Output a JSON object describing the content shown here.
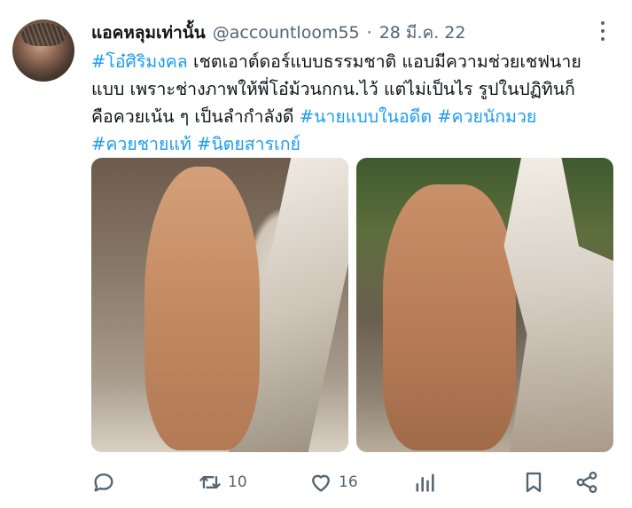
{
  "tweet": {
    "display_name": "แอคหลุมเท่านั้น",
    "handle": "@accountloom55",
    "separator": "·",
    "date": "28 มี.ค. 22",
    "lines": [
      [
        {
          "t": "#โอ๋ศิริมงคล",
          "tag": true
        },
        {
          "t": " เชตเอาต์ดอร์แบบธรรมชาติ แอบมีความช่วยเชฟนาย",
          "tag": false
        }
      ],
      [
        {
          "t": "แบบ เพราะช่างภาพให้พี่โอ๋ม้วนกกน.ไว้ แต่ไม่เป็นไร รูปในปฏิทินก็",
          "tag": false
        }
      ],
      [
        {
          "t": "คือควยเน้น ๆ เป็นลำกำลังดี ",
          "tag": false
        },
        {
          "t": "#นายแบบในอดีต",
          "tag": true
        },
        {
          "t": " ",
          "tag": false
        },
        {
          "t": "#ควยนักมวย",
          "tag": true
        }
      ],
      [
        {
          "t": "#ควยชายแท้",
          "tag": true
        },
        {
          "t": " ",
          "tag": false
        },
        {
          "t": "#นิตยสารเกย์",
          "tag": true
        }
      ]
    ]
  },
  "actions": {
    "reply_count": "",
    "retweet_count": "10",
    "like_count": "16",
    "views_count": ""
  },
  "icons": [
    "reply-icon",
    "retweet-icon",
    "heart-icon",
    "views-icon",
    "bookmark-icon",
    "share-icon",
    "more-icon"
  ],
  "colors": {
    "link": "#1d9bf0",
    "muted": "#536471",
    "text": "#0f1419"
  }
}
